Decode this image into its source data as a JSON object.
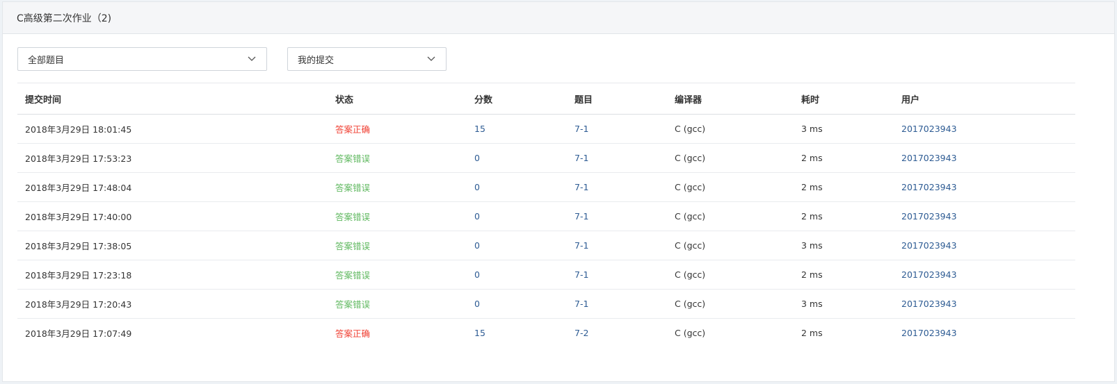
{
  "header": {
    "title": "C高级第二次作业（2)"
  },
  "filters": {
    "problem_select": "全部题目",
    "submission_select": "我的提交"
  },
  "table": {
    "columns": [
      "提交时间",
      "状态",
      "分数",
      "题目",
      "编译器",
      "耗时",
      "用户"
    ],
    "rows": [
      {
        "time": "2018年3月29日 18:01:45",
        "status": "答案正确",
        "status_type": "accepted",
        "score": "15",
        "problem": "7-1",
        "compiler": "C (gcc)",
        "duration": "3 ms",
        "user": "2017023943"
      },
      {
        "time": "2018年3月29日 17:53:23",
        "status": "答案错误",
        "status_type": "wrong",
        "score": "0",
        "problem": "7-1",
        "compiler": "C (gcc)",
        "duration": "2 ms",
        "user": "2017023943"
      },
      {
        "time": "2018年3月29日 17:48:04",
        "status": "答案错误",
        "status_type": "wrong",
        "score": "0",
        "problem": "7-1",
        "compiler": "C (gcc)",
        "duration": "2 ms",
        "user": "2017023943"
      },
      {
        "time": "2018年3月29日 17:40:00",
        "status": "答案错误",
        "status_type": "wrong",
        "score": "0",
        "problem": "7-1",
        "compiler": "C (gcc)",
        "duration": "2 ms",
        "user": "2017023943"
      },
      {
        "time": "2018年3月29日 17:38:05",
        "status": "答案错误",
        "status_type": "wrong",
        "score": "0",
        "problem": "7-1",
        "compiler": "C (gcc)",
        "duration": "3 ms",
        "user": "2017023943"
      },
      {
        "time": "2018年3月29日 17:23:18",
        "status": "答案错误",
        "status_type": "wrong",
        "score": "0",
        "problem": "7-1",
        "compiler": "C (gcc)",
        "duration": "2 ms",
        "user": "2017023943"
      },
      {
        "time": "2018年3月29日 17:20:43",
        "status": "答案错误",
        "status_type": "wrong",
        "score": "0",
        "problem": "7-1",
        "compiler": "C (gcc)",
        "duration": "3 ms",
        "user": "2017023943"
      },
      {
        "time": "2018年3月29日 17:07:49",
        "status": "答案正确",
        "status_type": "accepted",
        "score": "15",
        "problem": "7-2",
        "compiler": "C (gcc)",
        "duration": "2 ms",
        "user": "2017023943"
      }
    ]
  },
  "colors": {
    "accepted": "#f04134",
    "wrong": "#5fb85f",
    "link": "#2d5b93"
  },
  "icons": {
    "select_arrow": "chevron-down-icon"
  }
}
